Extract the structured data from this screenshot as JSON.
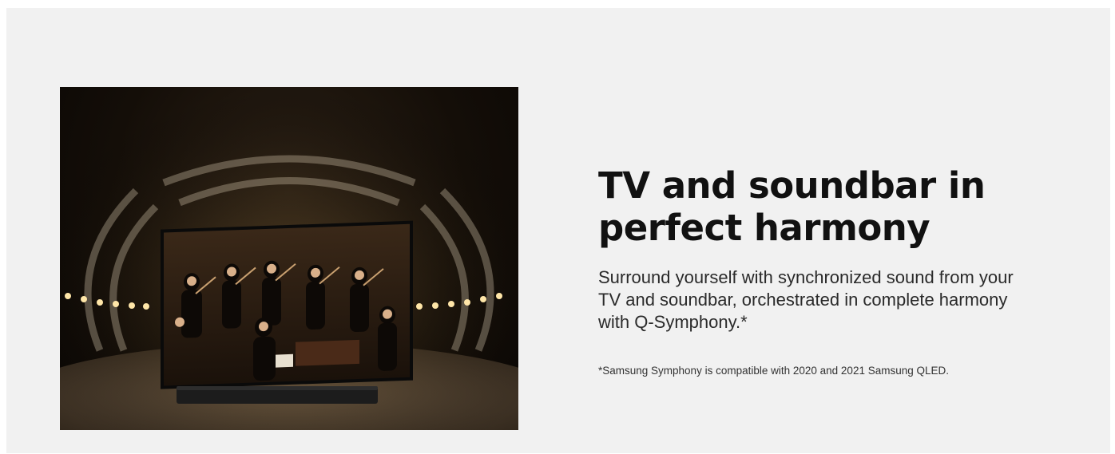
{
  "feature": {
    "headline_line1": "TV and soundbar in",
    "headline_line2": "perfect harmony",
    "description": "Surround yourself with synchronized sound from your TV and soundbar, orchestrated in complete harmony with Q-Symphony.*",
    "footnote": "*Samsung Symphony is compatible with 2020 and 2021 Samsung QLED."
  },
  "colors": {
    "background": "#f1f1f1",
    "headline": "#111111",
    "body": "#2a2a2a"
  }
}
